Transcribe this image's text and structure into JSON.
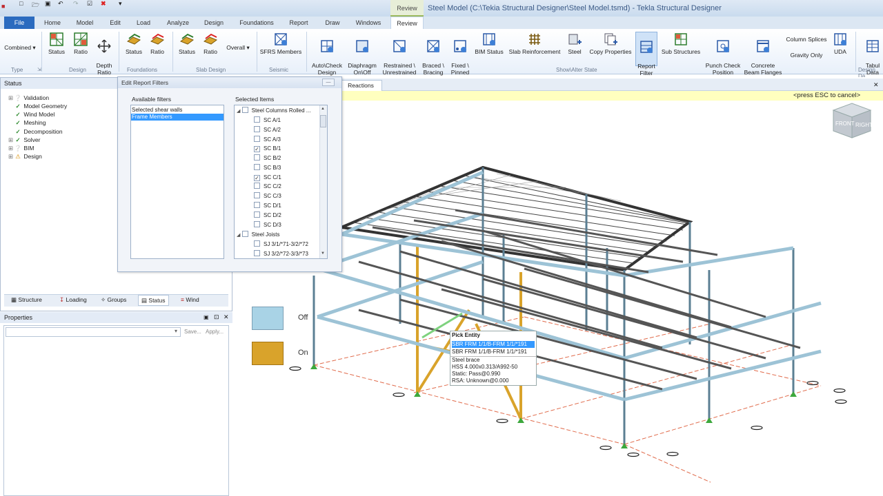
{
  "window": {
    "title": "Steel Model (C:\\Tekia Structural Designer\\Steel Model.tsmd) - Tekla Structural Designer",
    "context_tab": "Review"
  },
  "menu_tabs": [
    "File",
    "Home",
    "Model",
    "Edit",
    "Load",
    "Analyze",
    "Design",
    "Foundations",
    "Report",
    "Draw",
    "Windows",
    "Review"
  ],
  "ribbon": {
    "combined_label": "Combined",
    "buttons": {
      "design_status": "Status",
      "design_ratio": "Ratio",
      "depth_ratio": "Depth\nRatio",
      "found_status": "Status",
      "found_ratio": "Ratio",
      "slab_status": "Status",
      "slab_ratio": "Ratio",
      "overall": "Overall",
      "sfrs_members": "SFRS Members",
      "autocheck": "Auto\\Check\nDesign",
      "diaphragm": "Diaphragm\nOn\\Off",
      "restrained": "Restrained \\\nUnrestrained",
      "braced": "Braced \\\nBracing",
      "fixed_pinned": "Fixed \\\nPinned",
      "bim_status": "BIM Status",
      "slab_reinf": "Slab Reinforcement",
      "steel": "Steel",
      "copy_props": "Copy Properties",
      "report_filter": "Report\nFilter",
      "sub_structures": "Sub Structures",
      "punch_check": "Punch Check\nPosition",
      "concrete_flanges": "Concrete\nBeam Flanges",
      "column_splices": "Column Splices",
      "gravity_only": "Gravity Only",
      "uda": "UDA",
      "tabular": "Tabul\nData"
    },
    "groups": {
      "type": "Type",
      "design": "Design",
      "foundations": "Foundations",
      "slab_design": "Slab Design",
      "seismic": "Seismic",
      "show_alter": "Show\\Alter State",
      "design_data": "Design Da"
    }
  },
  "status_pane": {
    "title": "Status",
    "items": [
      {
        "label": "Validation",
        "state": "info",
        "expandable": true
      },
      {
        "label": "Model Geometry",
        "state": "ok",
        "expandable": false
      },
      {
        "label": "Wind Model",
        "state": "ok",
        "expandable": false
      },
      {
        "label": "Meshing",
        "state": "ok",
        "expandable": false
      },
      {
        "label": "Decomposition",
        "state": "ok",
        "expandable": false
      },
      {
        "label": "Solver",
        "state": "ok",
        "expandable": true
      },
      {
        "label": "BIM",
        "state": "info",
        "expandable": true
      },
      {
        "label": "Design",
        "state": "warn",
        "expandable": true
      }
    ],
    "bottom_tabs": [
      "Structure",
      "Loading",
      "Groups",
      "Status",
      "Wind"
    ]
  },
  "properties_pane": {
    "title": "Properties",
    "save_label": "Save...",
    "apply_label": "Apply..."
  },
  "dialog": {
    "title": "Edit Report Filters",
    "available_label": "Available filters",
    "selected_label": "Selected Items",
    "available_filters": [
      {
        "label": "Selected shear walls",
        "selected": false
      },
      {
        "label": "Frame Members",
        "selected": true
      }
    ],
    "selected_items": [
      {
        "label": "Steel Columns Rolled ...",
        "group": true,
        "checked": false
      },
      {
        "label": "SC A/1",
        "checked": false
      },
      {
        "label": "SC A/2",
        "checked": false
      },
      {
        "label": "SC A/3",
        "checked": false
      },
      {
        "label": "SC B/1",
        "checked": true
      },
      {
        "label": "SC B/2",
        "checked": false
      },
      {
        "label": "SC B/3",
        "checked": false
      },
      {
        "label": "SC C/1",
        "checked": true
      },
      {
        "label": "SC C/2",
        "checked": false
      },
      {
        "label": "SC C/3",
        "checked": false
      },
      {
        "label": "SC D/1",
        "checked": false
      },
      {
        "label": "SC D/2",
        "checked": false
      },
      {
        "label": "SC D/3",
        "checked": false
      },
      {
        "label": "Steel Joists",
        "group": true,
        "checked": false
      },
      {
        "label": "SJ 3/1/*71-3/2/*72",
        "checked": false
      },
      {
        "label": "SJ 3/2/*72-3/3/*73",
        "checked": false
      }
    ]
  },
  "viewport": {
    "tab": "Reactions",
    "esc_hint": "<press ESC to cancel>",
    "legend": {
      "off": "Off",
      "on": "On",
      "off_color": "#a9d3e6",
      "on_color": "#d9a32b"
    },
    "viewcube": {
      "front": "FRONT",
      "right": "RIGHT"
    },
    "pick": {
      "title": "Pick Entity",
      "options": [
        "SBR FRM 1/1/B-FRM 1/1/*191",
        "SBR FRM 1/1/B-FRM 1/1/*191"
      ],
      "details": [
        "Steel brace",
        "HSS 4.000x0.313/A992-50",
        "Static: Pass@0.990",
        "RSA: Unknown@0.000"
      ]
    }
  }
}
